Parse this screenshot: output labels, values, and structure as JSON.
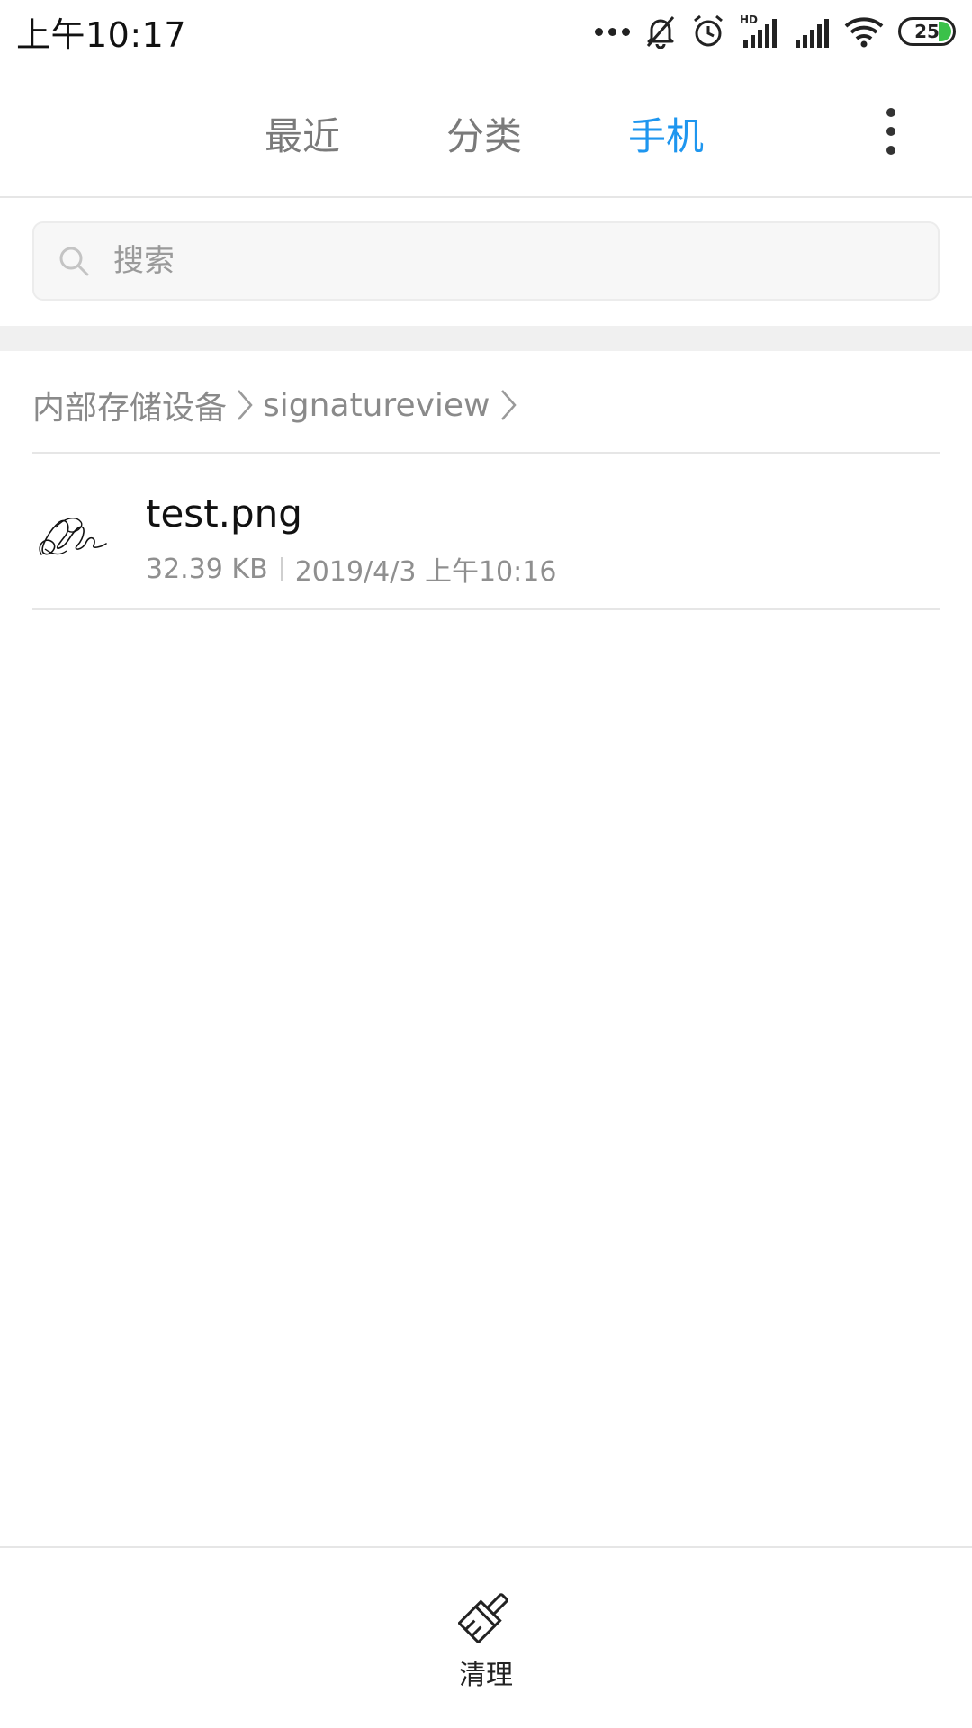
{
  "status_bar": {
    "time": "上午10:17",
    "battery_level": "25",
    "network_label": "HD",
    "icons": [
      "more-dots-icon",
      "bell-off-icon",
      "alarm-icon",
      "hd-signal-icon",
      "signal-icon",
      "wifi-icon",
      "battery-icon"
    ]
  },
  "tabs": {
    "recent": "最近",
    "category": "分类",
    "phone": "手机",
    "active": "phone",
    "active_color": "#1e96ef"
  },
  "search": {
    "placeholder": "搜索"
  },
  "breadcrumb": {
    "items": [
      "内部存储设备",
      "signatureview"
    ]
  },
  "files": [
    {
      "name": "test.png",
      "size": "32.39 KB",
      "date": "2019/4/3 上午10:16",
      "thumbnail": "signature-thumbnail"
    }
  ],
  "bottom_bar": {
    "clean_label": "清理",
    "clean_icon": "brush-icon"
  }
}
